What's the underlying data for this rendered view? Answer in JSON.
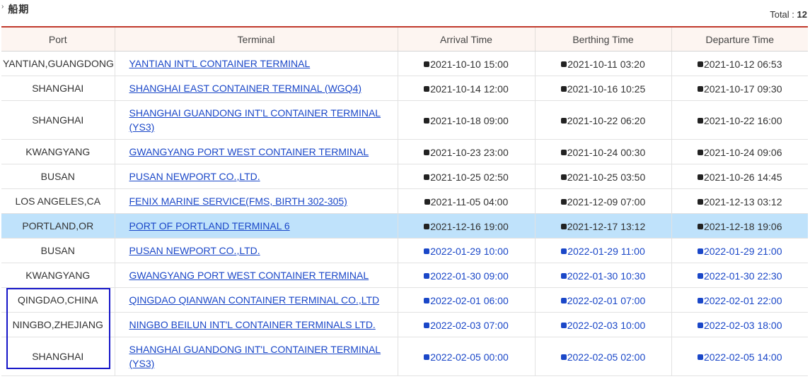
{
  "section": {
    "chevron": "›",
    "title": "船期"
  },
  "total": {
    "label": "Total :",
    "value": "12"
  },
  "headers": [
    "Port",
    "Terminal",
    "Arrival Time",
    "Berthing Time",
    "Departure Time"
  ],
  "status_colors": {
    "actual": "#222222",
    "estimated": "#1a47c8",
    "highlight_row": "#bfe2fb",
    "header_accent": "#c0392b"
  },
  "rows": [
    {
      "port": "YANTIAN,GUANGDONG",
      "terminal": "YANTIAN INT'L CONTAINER TERMINAL",
      "arrival": "2021-10-10 15:00",
      "berthing": "2021-10-11 03:20",
      "departure": "2021-10-12 06:53",
      "status": "actual"
    },
    {
      "port": "SHANGHAI",
      "terminal": "SHANGHAI EAST CONTAINER TERMINAL (WGQ4)",
      "arrival": "2021-10-14 12:00",
      "berthing": "2021-10-16 10:25",
      "departure": "2021-10-17 09:30",
      "status": "actual"
    },
    {
      "port": "SHANGHAI",
      "terminal": "SHANGHAI GUANDONG INT'L CONTAINER TERMINAL (YS3)",
      "arrival": "2021-10-18 09:00",
      "berthing": "2021-10-22 06:20",
      "departure": "2021-10-22 16:00",
      "status": "actual",
      "tall": true
    },
    {
      "port": "KWANGYANG",
      "terminal": "GWANGYANG PORT WEST CONTAINER TERMINAL",
      "arrival": "2021-10-23 23:00",
      "berthing": "2021-10-24 00:30",
      "departure": "2021-10-24 09:06",
      "status": "actual"
    },
    {
      "port": "BUSAN",
      "terminal": "PUSAN NEWPORT CO.,LTD.",
      "arrival": "2021-10-25 02:50",
      "berthing": "2021-10-25 03:50",
      "departure": "2021-10-26 14:45",
      "status": "actual"
    },
    {
      "port": "LOS ANGELES,CA",
      "terminal": "FENIX MARINE SERVICE(FMS, BIRTH 302-305)",
      "arrival": "2021-11-05 04:00",
      "berthing": "2021-12-09 07:00",
      "departure": "2021-12-13 03:12",
      "status": "actual"
    },
    {
      "port": "PORTLAND,OR",
      "terminal": "PORT OF PORTLAND TERMINAL 6",
      "arrival": "2021-12-16 19:00",
      "berthing": "2021-12-17 13:12",
      "departure": "2021-12-18 19:06",
      "status": "actual",
      "highlight": true
    },
    {
      "port": "BUSAN",
      "terminal": "PUSAN NEWPORT CO.,LTD.",
      "arrival": "2022-01-29 10:00",
      "berthing": "2022-01-29 11:00",
      "departure": "2022-01-29 21:00",
      "status": "estimated"
    },
    {
      "port": "KWANGYANG",
      "terminal": "GWANGYANG PORT WEST CONTAINER TERMINAL",
      "arrival": "2022-01-30 09:00",
      "berthing": "2022-01-30 10:30",
      "departure": "2022-01-30 22:30",
      "status": "estimated"
    },
    {
      "port": "QINGDAO,CHINA",
      "terminal": "QINGDAO QIANWAN CONTAINER TERMINAL CO.,LTD",
      "arrival": "2022-02-01 06:00",
      "berthing": "2022-02-01 07:00",
      "departure": "2022-02-01 22:00",
      "status": "estimated"
    },
    {
      "port": "NINGBO,ZHEJIANG",
      "terminal": "NINGBO BEILUN INT'L CONTAINER TERMINALS LTD.",
      "arrival": "2022-02-03 07:00",
      "berthing": "2022-02-03 10:00",
      "departure": "2022-02-03 18:00",
      "status": "estimated"
    },
    {
      "port": "SHANGHAI",
      "terminal": "SHANGHAI GUANDONG INT'L CONTAINER TERMINAL (YS3)",
      "arrival": "2022-02-05 00:00",
      "berthing": "2022-02-05 02:00",
      "departure": "2022-02-05 14:00",
      "status": "estimated",
      "tall": true
    }
  ]
}
